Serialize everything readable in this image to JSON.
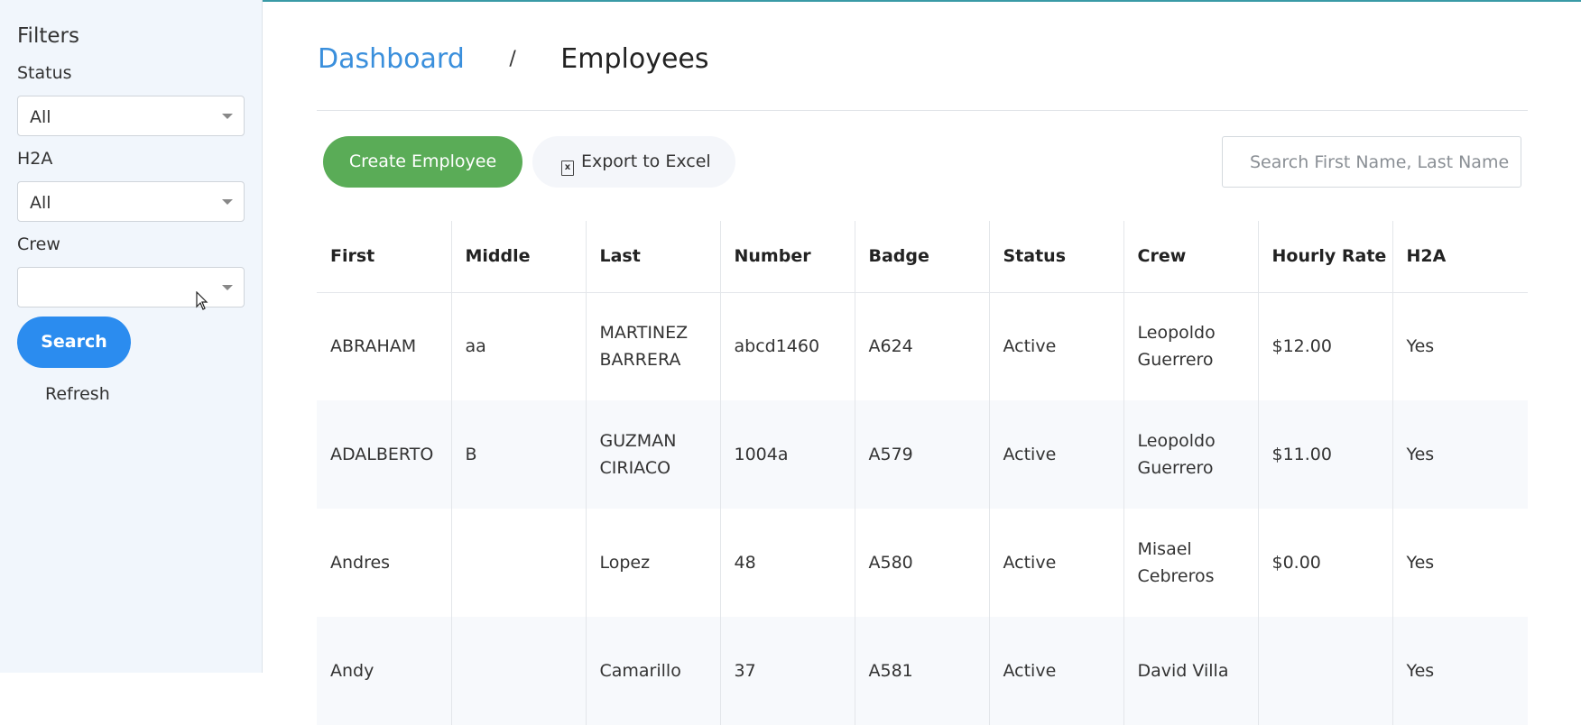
{
  "sidebar": {
    "title": "Filters",
    "status_label": "Status",
    "status_value": "All",
    "h2a_label": "H2A",
    "h2a_value": "All",
    "crew_label": "Crew",
    "crew_value": "",
    "search_label": "Search",
    "refresh_label": "Refresh"
  },
  "breadcrumb": {
    "parent": "Dashboard",
    "separator": "/",
    "current": "Employees"
  },
  "toolbar": {
    "create_label": "Create Employee",
    "export_label": "Export to Excel",
    "search_placeholder": "Search First Name, Last Name"
  },
  "table": {
    "headers": [
      "First",
      "Middle",
      "Last",
      "Number",
      "Badge",
      "Status",
      "Crew",
      "Hourly Rate",
      "H2A"
    ],
    "rows": [
      {
        "first": "ABRAHAM",
        "middle": "aa",
        "last": "MARTINEZ BARRERA",
        "number": "abcd1460",
        "badge": "A624",
        "status": "Active",
        "crew": "Leopoldo Guerrero",
        "rate": "$12.00",
        "h2a": "Yes"
      },
      {
        "first": "ADALBERTO",
        "middle": "B",
        "last": "GUZMAN CIRIACO",
        "number": "1004a",
        "badge": "A579",
        "status": "Active",
        "crew": "Leopoldo Guerrero",
        "rate": "$11.00",
        "h2a": "Yes"
      },
      {
        "first": "Andres",
        "middle": "",
        "last": "Lopez",
        "number": "48",
        "badge": "A580",
        "status": "Active",
        "crew": "Misael Cebreros",
        "rate": "$0.00",
        "h2a": "Yes"
      },
      {
        "first": "Andy",
        "middle": "",
        "last": "Camarillo",
        "number": "37",
        "badge": "A581",
        "status": "Active",
        "crew": "David Villa",
        "rate": "",
        "h2a": "Yes"
      }
    ]
  }
}
